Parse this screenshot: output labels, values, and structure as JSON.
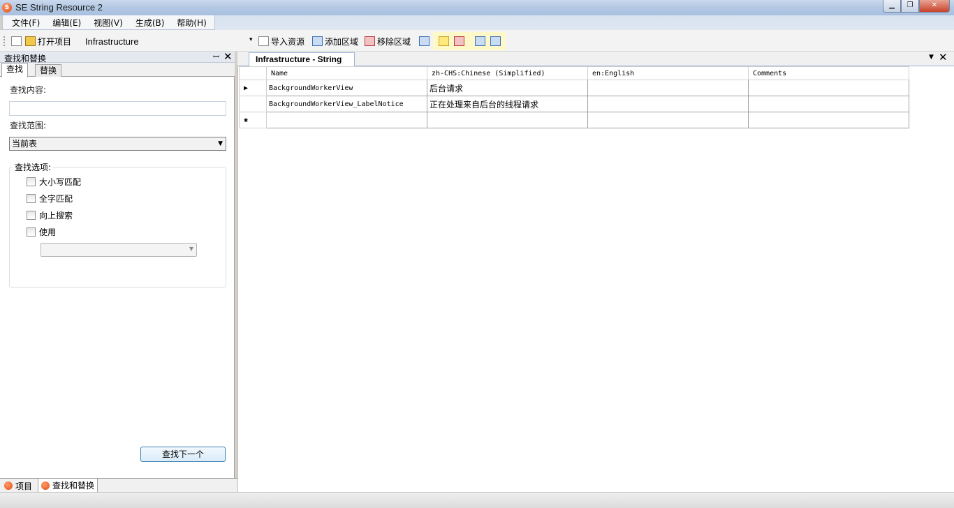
{
  "window": {
    "title": "SE String Resource 2",
    "minimize": "▁",
    "maximize": "❐",
    "close": "✕"
  },
  "menu": [
    "文件(F)",
    "编辑(E)",
    "视图(V)",
    "生成(B)",
    "帮助(H)"
  ],
  "toolbar": {
    "open_project": "打开项目",
    "project_name": "Infrastructure",
    "dropdown_arrow": "▾",
    "import_resources": "导入资源",
    "add_region": "添加区域",
    "remove_region": "移除区域"
  },
  "left_panel": {
    "title": "查找和替换",
    "pin": "ꟷ",
    "close": "✕",
    "tabs": [
      "查找",
      "替换"
    ],
    "find_label": "查找内容:",
    "find_value": "",
    "scope_label": "查找范围:",
    "scope_value": "当前表",
    "scope_arrow": "▼",
    "options_label": "查找选项:",
    "options": [
      "大小写匹配",
      "全字匹配",
      "向上搜索",
      "使用"
    ],
    "use_select_arrow": "▼",
    "find_next_button": "查找下一个"
  },
  "bottom_tabs": [
    "项目",
    "查找和替换"
  ],
  "document": {
    "tab_title": "Infrastructure - String",
    "tab_dropdown": "▼",
    "tab_close": "✕",
    "columns": [
      "Name",
      "zh-CHS:Chinese (Simplified)",
      "en:English",
      "Comments"
    ],
    "rows": [
      {
        "marker": "▶",
        "name": "BackgroundWorkerView",
        "zh": "后台请求",
        "en": "",
        "comments": ""
      },
      {
        "marker": "",
        "name": "BackgroundWorkerView_LabelNotice",
        "zh": "正在处理来自后台的线程请求",
        "en": "",
        "comments": ""
      }
    ],
    "new_row_marker": "✱"
  }
}
